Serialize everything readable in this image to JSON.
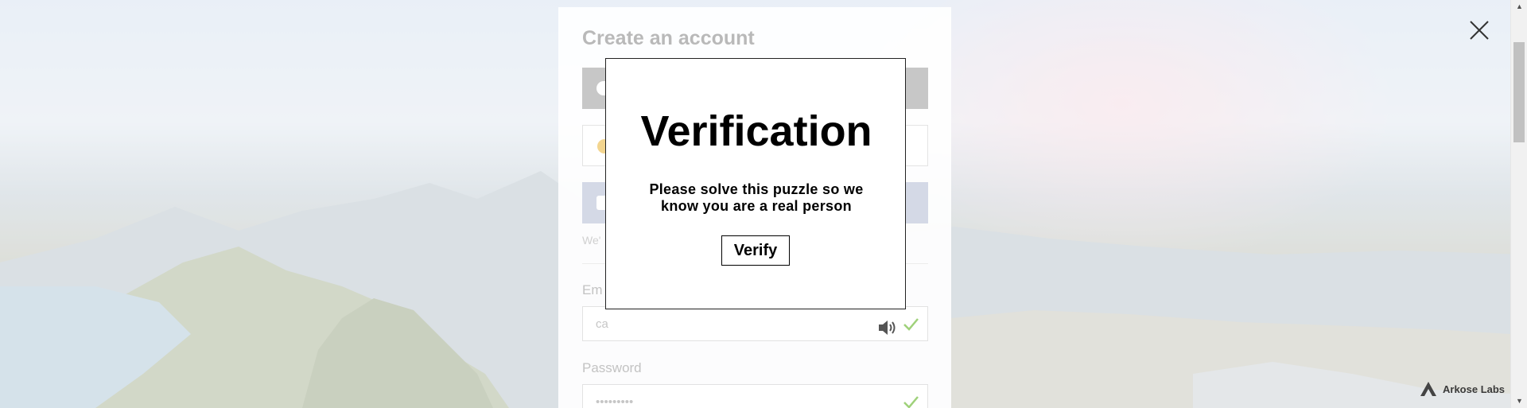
{
  "background": {
    "description_color": "#dde6f2"
  },
  "card": {
    "title": "Create an account",
    "note_text": "We'",
    "email_label": "Em",
    "email_value": "ca",
    "password_label": "Password",
    "password_value": "•••••••••"
  },
  "modal": {
    "title": "Verification",
    "instructions": "Please solve this puzzle so we know you are a real person",
    "verify_label": "Verify"
  },
  "brand": {
    "name": "Arkose Labs"
  },
  "icons": {
    "close": "close-icon",
    "audio": "speaker-icon",
    "check": "checkmark-icon",
    "brand": "arkose-logo-icon"
  },
  "colors": {
    "check": "#9fd17a",
    "modal_border": "#222222",
    "card_title": "#b9b9b9"
  }
}
